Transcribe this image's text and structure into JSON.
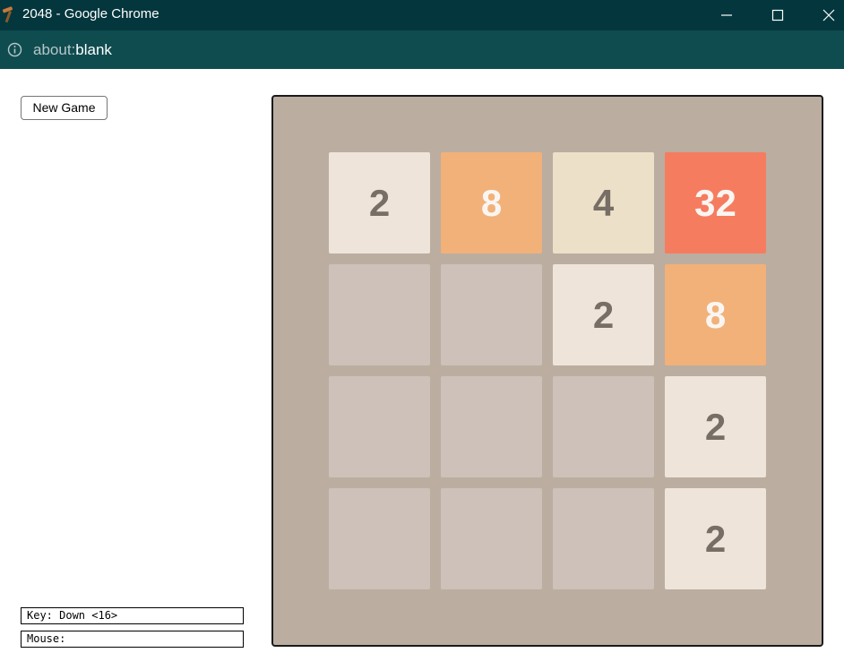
{
  "window": {
    "title": "2048 - Google Chrome",
    "icon": "hammer-icon",
    "controls": [
      "minimize-icon",
      "maximize-icon",
      "close-icon"
    ]
  },
  "addressbar": {
    "icon": "info-icon",
    "url_scheme": "about:",
    "url_host": "blank"
  },
  "controls": {
    "new_game_label": "New Game"
  },
  "status": {
    "key": "Key: Down <16>",
    "mouse": "Mouse:"
  },
  "board": {
    "size": 4,
    "grid": [
      [
        2,
        8,
        4,
        32
      ],
      [
        0,
        0,
        2,
        8
      ],
      [
        0,
        0,
        0,
        2
      ],
      [
        0,
        0,
        0,
        2
      ]
    ]
  },
  "colors": {
    "board_background": "#bbada0",
    "empty_cell": "#cdc1b9",
    "tiles": {
      "2": {
        "bg": "#eee4da",
        "fg": "#776e65"
      },
      "4": {
        "bg": "#ede0c8",
        "fg": "#776e65"
      },
      "8": {
        "bg": "#f2b179",
        "fg": "#f9f6f2"
      },
      "32": {
        "bg": "#f67c5f",
        "fg": "#f9f6f2"
      }
    }
  }
}
